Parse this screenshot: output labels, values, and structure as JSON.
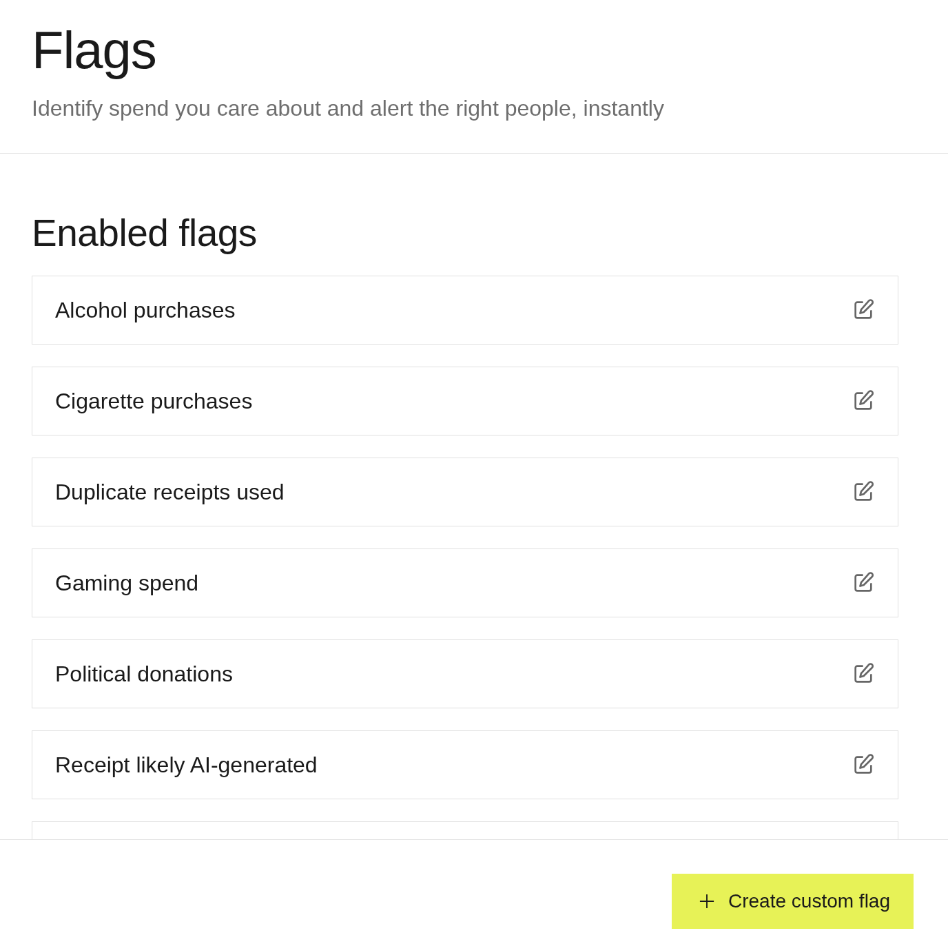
{
  "header": {
    "title": "Flags",
    "subtitle": "Identify spend you care about and alert the right people, instantly"
  },
  "enabled_flags": {
    "heading": "Enabled flags",
    "items": [
      {
        "label": "Alcohol purchases"
      },
      {
        "label": "Cigarette purchases"
      },
      {
        "label": "Duplicate receipts used"
      },
      {
        "label": "Gaming spend"
      },
      {
        "label": "Political donations"
      },
      {
        "label": "Receipt likely AI-generated"
      }
    ],
    "more_below": true
  },
  "footer": {
    "button": {
      "label": "Create custom flag"
    }
  }
}
